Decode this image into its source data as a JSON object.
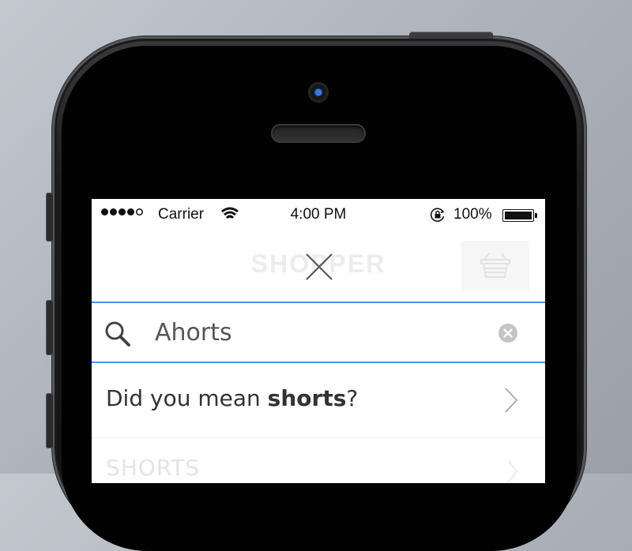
{
  "status_bar": {
    "carrier": "Carrier",
    "time": "4:00 PM",
    "battery": "100%",
    "signal_bars": 4,
    "signal_total": 5
  },
  "nav": {
    "brand": "SHOPPER",
    "close_icon": "close-x-icon",
    "cart_icon": "basket-icon"
  },
  "search": {
    "value": "Ahorts",
    "placeholder": "",
    "accent_color": "#4d8fe8"
  },
  "suggestion": {
    "prefix": "Did you mean ",
    "term": "shorts",
    "suffix": "?"
  },
  "results": [
    {
      "label": "SHORTS"
    }
  ]
}
